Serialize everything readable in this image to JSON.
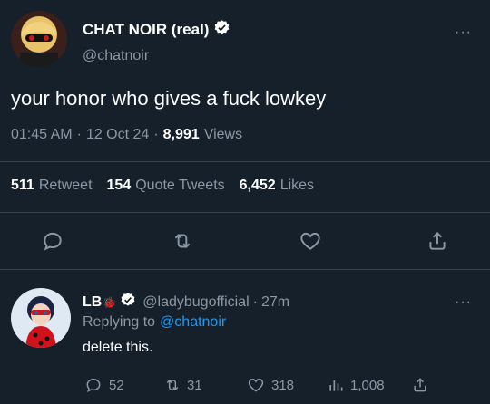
{
  "main_tweet": {
    "display_name": "CHAT NOIR (real)",
    "handle": "@chatnoir",
    "text": "your honor who gives a fuck lowkey",
    "time": "01:45 AM",
    "sep1": "·",
    "date": "12 Oct 24",
    "sep2": "·",
    "views_count": "8,991",
    "views_label": "Views",
    "retweets_count": "511",
    "retweets_label": "Retweet",
    "quotes_count": "154",
    "quotes_label": "Quote Tweets",
    "likes_count": "6,452",
    "likes_label": "Likes",
    "more": "···"
  },
  "reply": {
    "display_name": "LB",
    "emoji": "🐞",
    "handle": "@ladybugofficial",
    "sep": "·",
    "age": "27m",
    "replying_prefix": "Replying to",
    "replying_handle": "@chatnoir",
    "text": "delete this.",
    "replies": "52",
    "retweets": "31",
    "likes": "318",
    "views": "1,008",
    "more": "···"
  },
  "colors": {
    "background": "#15202b",
    "muted": "#8b98a5",
    "accent": "#1d9bf0",
    "divider": "#38444d"
  },
  "icons": [
    "verified-icon",
    "more-icon",
    "reply-icon",
    "retweet-icon",
    "like-icon",
    "share-icon",
    "views-icon"
  ]
}
